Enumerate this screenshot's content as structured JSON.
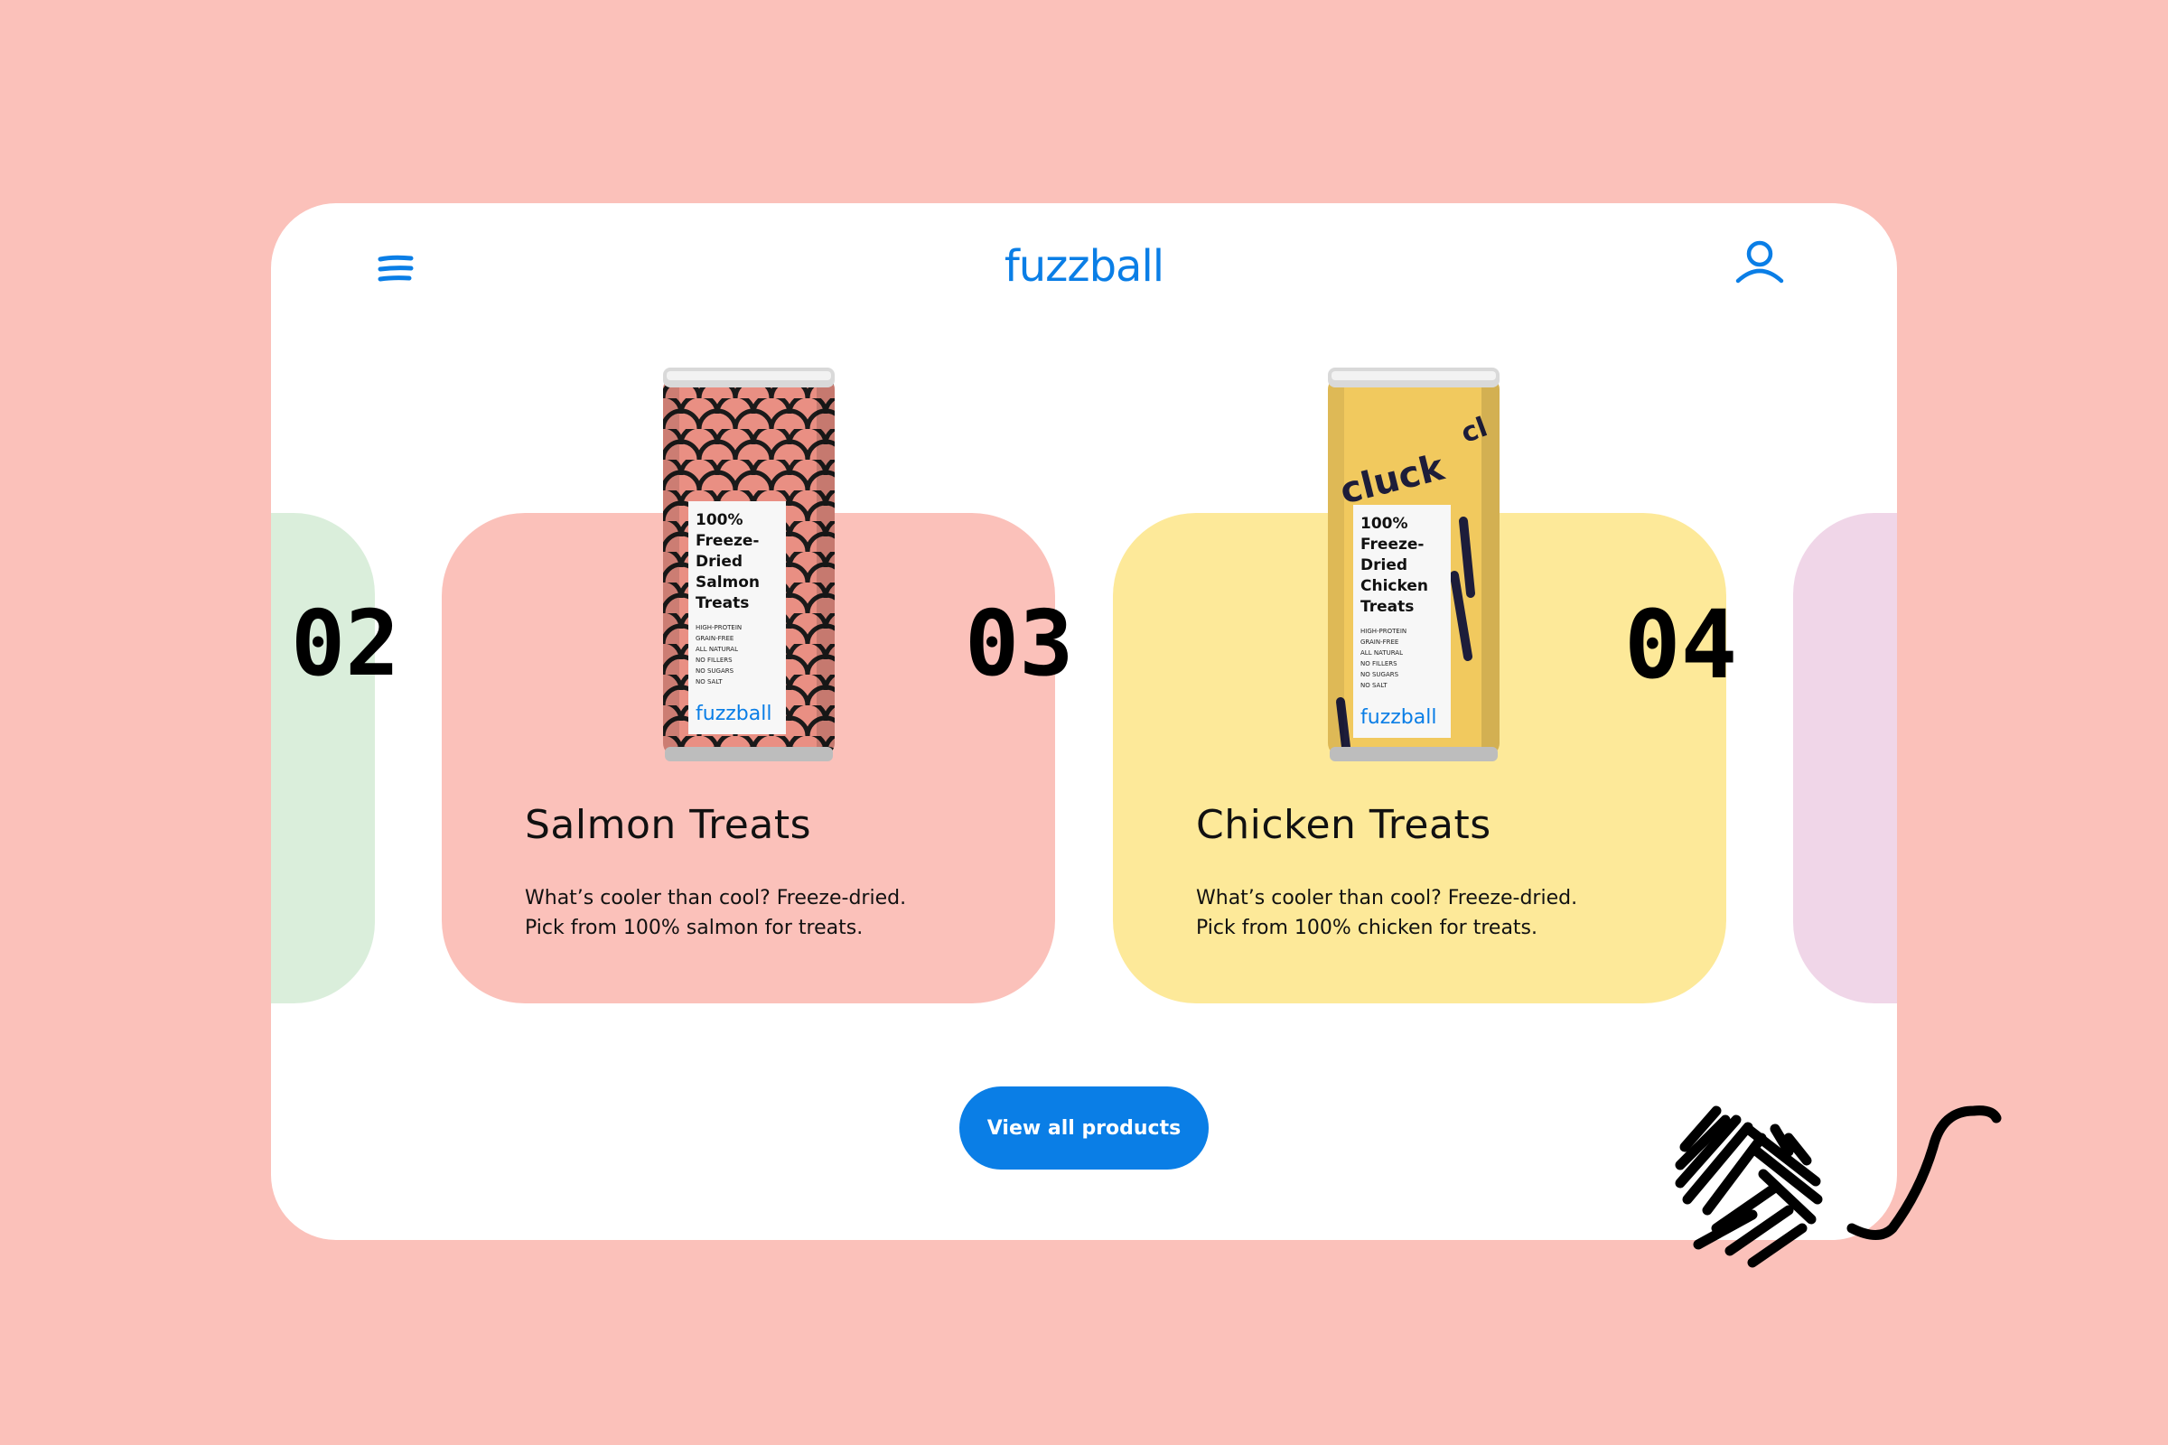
{
  "header": {
    "logo": "fuzzball",
    "menu_icon": "hamburger-menu-icon",
    "account_icon": "user-account-icon"
  },
  "carousel": {
    "items": [
      {
        "number": "02",
        "color": "#daeedb"
      },
      {
        "number": "03",
        "title": "Salmon Treats",
        "description_line1": "What’s cooler than cool? Freeze-dried.",
        "description_line2": "Pick from 100% salmon for treats.",
        "color": "#fbc1ba",
        "can": {
          "label_lines": [
            "100%",
            "Freeze-",
            "Dried",
            "Salmon",
            "Treats"
          ],
          "features": [
            "HIGH-PROTEIN",
            "GRAIN-FREE",
            "ALL NATURAL",
            "NO FILLERS",
            "NO SUGARS",
            "NO SALT"
          ],
          "brand": "fuzzball",
          "color": "#e98f83"
        }
      },
      {
        "number": "04",
        "title": "Chicken Treats",
        "description_line1": "What’s cooler than cool? Freeze-dried.",
        "description_line2": "Pick from 100% chicken for treats.",
        "color": "#fde999",
        "can": {
          "label_lines": [
            "100%",
            "Freeze-",
            "Dried",
            "Chicken",
            "Treats"
          ],
          "features": [
            "HIGH-PROTEIN",
            "GRAIN-FREE",
            "ALL NATURAL",
            "NO FILLERS",
            "NO SUGARS",
            "NO SALT"
          ],
          "brand": "fuzzball",
          "scribble": "cluck",
          "color": "#f1c95e"
        }
      },
      {
        "color": "#f0d6e8"
      }
    ]
  },
  "cta": {
    "label": "View all products"
  },
  "colors": {
    "background": "#fbc1ba",
    "brand_blue": "#0a7ee6",
    "surface": "#ffffff"
  }
}
